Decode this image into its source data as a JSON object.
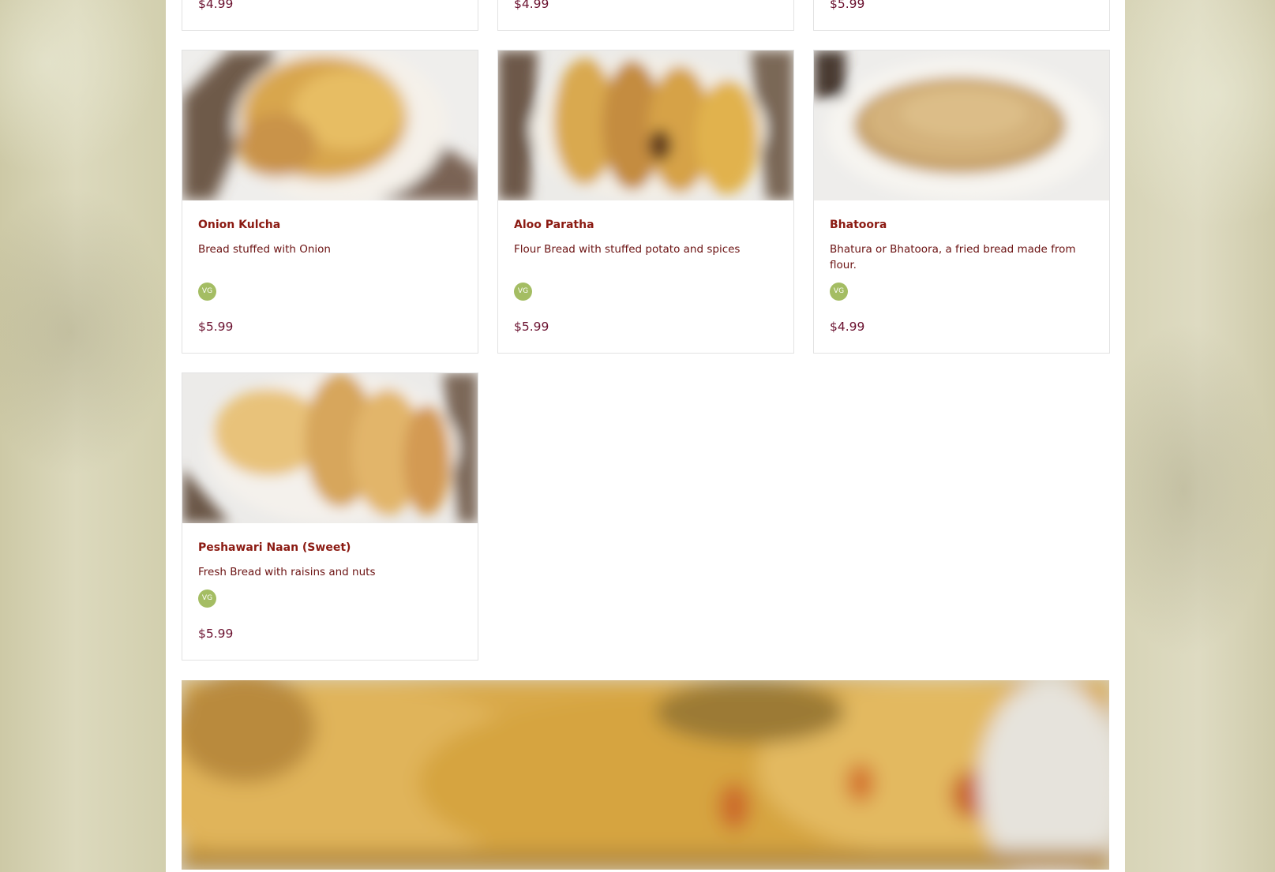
{
  "top_row_prices": [
    "$4.99",
    "$4.99",
    "$5.99"
  ],
  "menu_items": [
    {
      "name": "Onion Kulcha",
      "description": "Bread stuffed with Onion",
      "badge": "VG",
      "price": "$5.99",
      "image_icon": "onion-kulcha-photo"
    },
    {
      "name": "Aloo Paratha",
      "description": "Flour Bread with stuffed potato and spices",
      "badge": "VG",
      "price": "$5.99",
      "image_icon": "aloo-paratha-photo"
    },
    {
      "name": "Bhatoora",
      "description": "Bhatura or Bhatoora, a fried bread made from flour.",
      "badge": "VG",
      "price": "$4.99",
      "image_icon": "bhatoora-photo"
    },
    {
      "name": "Peshawari Naan (Sweet)",
      "description": "Fresh Bread with raisins and nuts",
      "badge": "VG",
      "price": "$5.99",
      "image_icon": "peshawari-naan-photo"
    }
  ],
  "colors": {
    "title": "#8b1a12",
    "price": "#6b1230",
    "badge": "#a4bd63",
    "card_border": "#e2e2e2",
    "background": "#d6d3b5"
  }
}
